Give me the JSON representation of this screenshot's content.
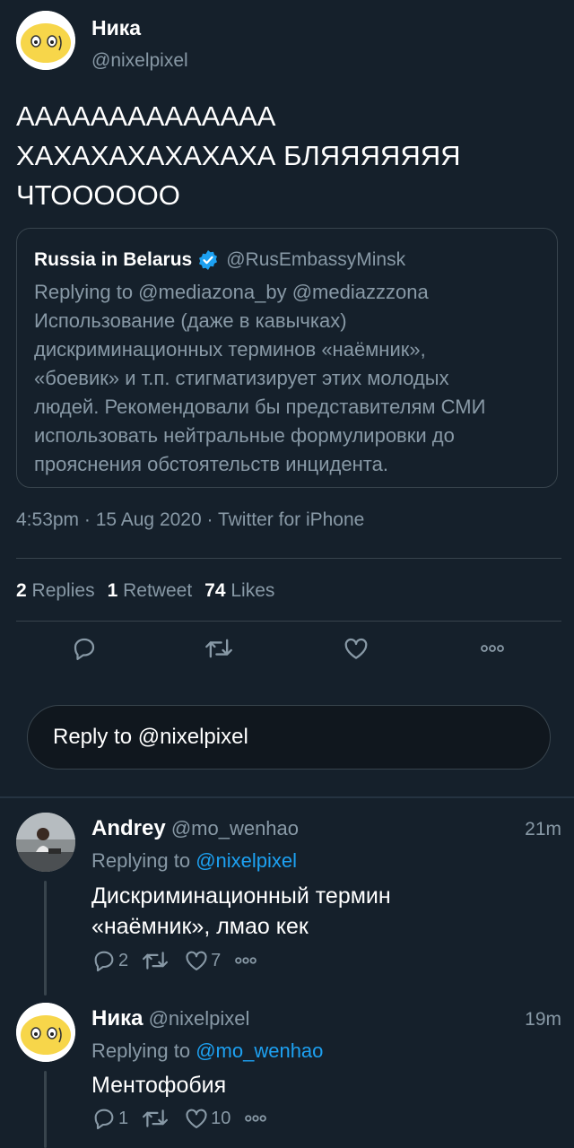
{
  "tweet": {
    "author_name": "Ника",
    "author_handle": "@nixelpixel",
    "text_lines": [
      "АААААААААААААА",
      "ХАХАХАХАХАХАХА БЛЯЯЯЯЯЯЯ",
      "ЧТОООООО"
    ],
    "timestamp": "4:53pm · 15 Aug 2020 · Twitter for iPhone",
    "stats": {
      "replies_count": "2",
      "replies_label": "Replies",
      "retweets_count": "1",
      "retweets_label": "Retweet",
      "likes_count": "74",
      "likes_label": "Likes"
    },
    "actions": {
      "reply_icon": "reply-icon",
      "retweet_icon": "retweet-icon",
      "like_icon": "like-icon",
      "more_icon": "more-icon"
    }
  },
  "quoted": {
    "author_name": "Russia in Belarus",
    "verified_icon": "verified-icon",
    "author_handle": "@RusEmbassyMinsk",
    "replying_line": "Replying to @mediazona_by @mediazzzona",
    "text_lines": [
      "Использование (даже в кавычках)",
      "дискриминационных терминов «наёмник»,",
      "«боевик» и т.п. стигматизирует этих молодых",
      "людей. Рекомендовали бы представителям СМИ",
      "использовать нейтральные формулировки до",
      "прояснения обстоятельств инцидента."
    ]
  },
  "reply_box": {
    "placeholder": "Reply to @nixelpixel"
  },
  "replies": [
    {
      "author_name": "Andrey",
      "author_handle": "@mo_wenhao",
      "time": "21m",
      "replying_prefix": "Replying to",
      "replying_to": "@nixelpixel",
      "text_lines": [
        "Дискриминационный термин",
        "«наёмник», лмао кек"
      ],
      "reply_count": "2",
      "retweet_count": "",
      "like_count": "7"
    },
    {
      "author_name": "Ника",
      "author_handle": "@nixelpixel",
      "time": "19m",
      "replying_prefix": "Replying to",
      "replying_to": "@mo_wenhao",
      "text_lines": [
        "Ментофобия"
      ],
      "reply_count": "1",
      "retweet_count": "",
      "like_count": "10"
    }
  ],
  "colors": {
    "background": "#15202b",
    "muted": "#8899a6",
    "link": "#1da1f2",
    "divider": "#38444d",
    "avatar_yellow": "#f7d64a"
  }
}
